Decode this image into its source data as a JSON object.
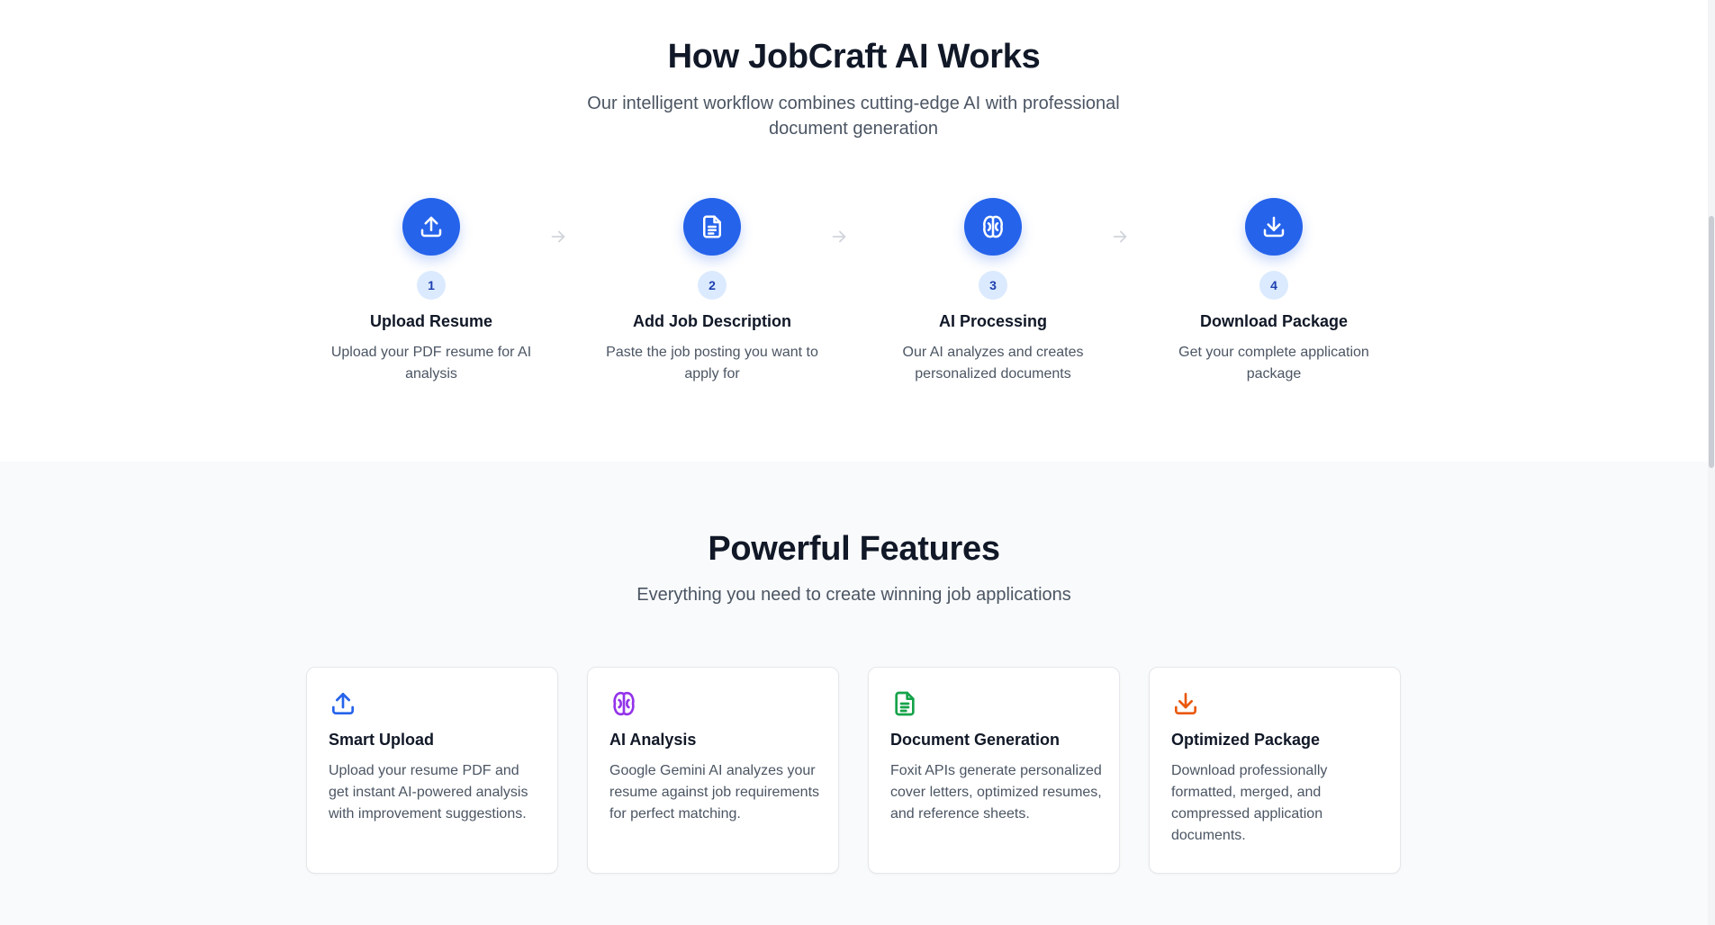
{
  "how_it_works": {
    "title": "How JobCraft AI Works",
    "subtitle": "Our intelligent workflow combines cutting-edge AI with professional document generation",
    "steps": [
      {
        "number": "1",
        "title": "Upload Resume",
        "description": "Upload your PDF resume for AI analysis",
        "icon": "upload-icon"
      },
      {
        "number": "2",
        "title": "Add Job Description",
        "description": "Paste the job posting you want to apply for",
        "icon": "document-icon"
      },
      {
        "number": "3",
        "title": "AI Processing",
        "description": "Our AI analyzes and creates personalized documents",
        "icon": "brain-icon"
      },
      {
        "number": "4",
        "title": "Download Package",
        "description": "Get your complete application package",
        "icon": "download-icon"
      }
    ],
    "arrow_icon": "arrow-right-icon"
  },
  "features": {
    "title": "Powerful Features",
    "subtitle": "Everything you need to create winning job applications",
    "cards": [
      {
        "title": "Smart Upload",
        "description": "Upload your resume PDF and get instant AI-powered analysis with improvement suggestions.",
        "icon": "upload-icon",
        "color": "#2563eb"
      },
      {
        "title": "AI Analysis",
        "description": "Google Gemini AI analyzes your resume against job requirements for perfect matching.",
        "icon": "brain-icon",
        "color": "#9333ea"
      },
      {
        "title": "Document Generation",
        "description": "Foxit APIs generate personalized cover letters, optimized resumes, and reference sheets.",
        "icon": "document-icon",
        "color": "#16a34a"
      },
      {
        "title": "Optimized Package",
        "description": "Download professionally formatted, merged, and compressed application documents.",
        "icon": "download-icon",
        "color": "#ea580c"
      }
    ]
  },
  "colors": {
    "accent": "#2563eb",
    "step_badge_bg": "#dbeafe",
    "features_bg": "#f9fafb"
  }
}
